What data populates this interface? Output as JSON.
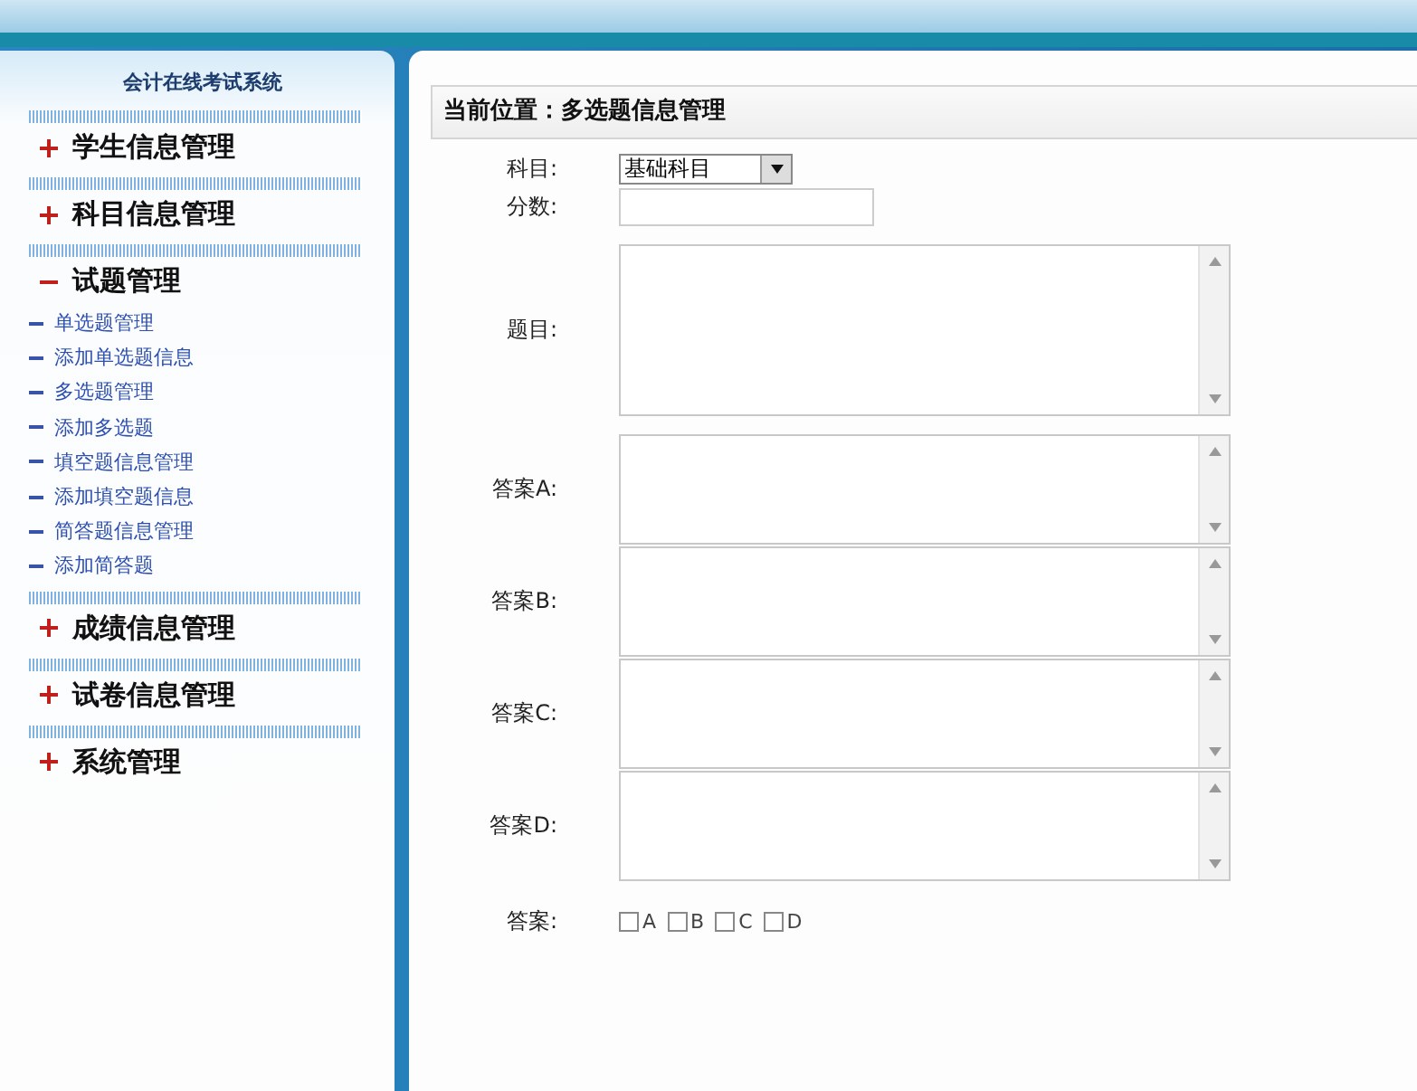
{
  "sidebar": {
    "title": "会计在线考试系统",
    "groups": [
      {
        "label": "学生信息管理",
        "expanded": false
      },
      {
        "label": "科目信息管理",
        "expanded": false
      },
      {
        "label": "试题管理",
        "expanded": true,
        "children": [
          {
            "label": "单选题管理"
          },
          {
            "label": "添加单选题信息"
          },
          {
            "label": "多选题管理"
          },
          {
            "label": "添加多选题"
          },
          {
            "label": "填空题信息管理"
          },
          {
            "label": "添加填空题信息"
          },
          {
            "label": "简答题信息管理"
          },
          {
            "label": "添加简答题"
          }
        ]
      },
      {
        "label": "成绩信息管理",
        "expanded": false
      },
      {
        "label": "试卷信息管理",
        "expanded": false
      },
      {
        "label": "系统管理",
        "expanded": false
      }
    ]
  },
  "breadcrumb": "当前位置：多选题信息管理",
  "form": [
    {
      "kind": "select",
      "label": "科目:",
      "value": "基础科目"
    },
    {
      "kind": "input",
      "label": "分数:"
    },
    {
      "kind": "question",
      "label": "题目:"
    },
    {
      "kind": "answer",
      "label": "答案A:"
    },
    {
      "kind": "answer",
      "label": "答案B:"
    },
    {
      "kind": "answer",
      "label": "答案C:"
    },
    {
      "kind": "answer",
      "label": "答案D:"
    },
    {
      "kind": "checkboxes",
      "label": "答案:",
      "options": [
        {
          "label": "A",
          "checked": false
        },
        {
          "label": "B",
          "checked": false
        },
        {
          "label": "C",
          "checked": false
        },
        {
          "label": "D",
          "checked": false
        }
      ]
    }
  ]
}
